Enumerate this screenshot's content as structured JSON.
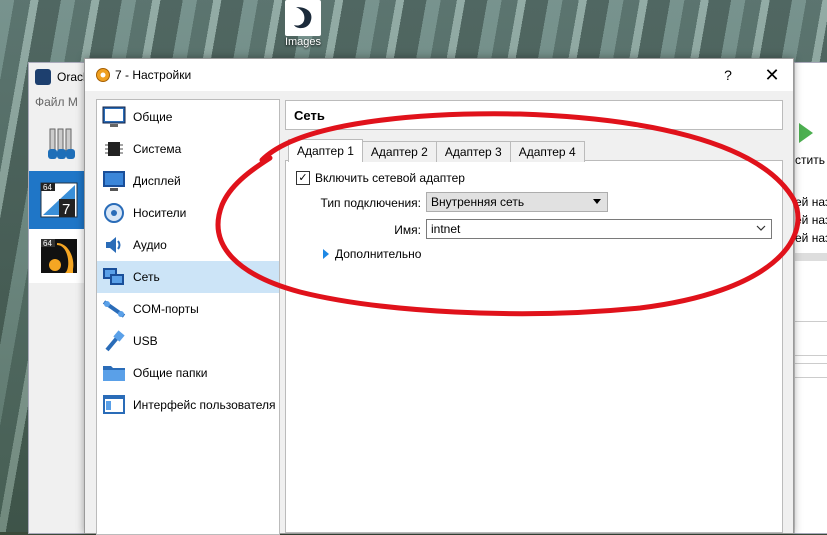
{
  "desktop": {
    "icon_label": "Images"
  },
  "manager": {
    "title": "Oracl",
    "menu": "Файл   M",
    "right_texts": [
      "стить",
      "ей наз",
      "ей наз",
      "ей наз"
    ],
    "vm1_badge": "64",
    "vm1_num": "7",
    "vm2_badge": "64"
  },
  "dialog": {
    "title": "7 - Настройки",
    "help": "?",
    "close": "✕"
  },
  "sidebar": {
    "items": [
      {
        "label": "Общие",
        "icon": "general-icon",
        "active": false
      },
      {
        "label": "Система",
        "icon": "system-icon",
        "active": false
      },
      {
        "label": "Дисплей",
        "icon": "display-icon",
        "active": false
      },
      {
        "label": "Носители",
        "icon": "storage-icon",
        "active": false
      },
      {
        "label": "Аудио",
        "icon": "audio-icon",
        "active": false
      },
      {
        "label": "Сеть",
        "icon": "network-icon",
        "active": true
      },
      {
        "label": "COM-порты",
        "icon": "serial-ports-icon",
        "active": false
      },
      {
        "label": "USB",
        "icon": "usb-icon",
        "active": false
      },
      {
        "label": "Общие папки",
        "icon": "shared-folders-icon",
        "active": false
      },
      {
        "label": "Интерфейс пользователя",
        "icon": "user-interface-icon",
        "active": false
      }
    ]
  },
  "network": {
    "section_title": "Сеть",
    "tabs": [
      "Адаптер 1",
      "Адаптер 2",
      "Адаптер 3",
      "Адаптер 4"
    ],
    "enable_label": "Включить сетевой адаптер",
    "enable_checked": true,
    "check_mark": "✓",
    "attachment_label": "Тип подключения:",
    "attachment_value": "Внутренняя сеть",
    "name_label": "Имя:",
    "name_value": "intnet",
    "advanced_label": "Дополнительно"
  },
  "colors": {
    "annotation": "#e0121b",
    "selection": "#cce4f7",
    "accent": "#1e88e5"
  }
}
